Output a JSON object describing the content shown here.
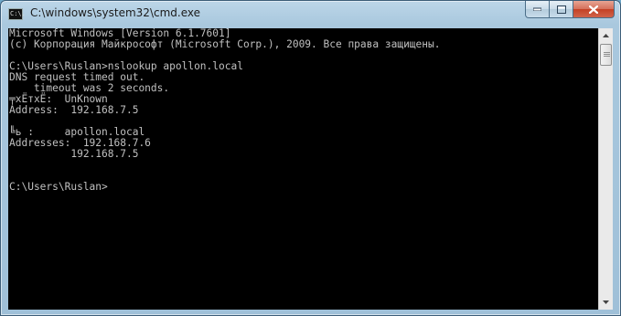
{
  "window": {
    "title": "C:\\windows\\system32\\cmd.exe",
    "icon": "cmd-icon",
    "icon_label": "C:\\.",
    "buttons": {
      "minimize": "minimize-icon",
      "maximize": "maximize-icon",
      "close": "close-icon"
    }
  },
  "console": {
    "lines": [
      "Microsoft Windows [Version 6.1.7601]",
      "(c) Корпорация Майкрософт (Microsoft Corp.), 2009. Все права защищены.",
      "",
      "C:\\Users\\Ruslan>nslookup apollon.local",
      "DNS request timed out.",
      "    timeout was 2 seconds.",
      "╤хЁтхЁ:  UnKnown",
      "Address:  192.168.7.5",
      "",
      "╚ь :     apollon.local",
      "Addresses:  192.168.7.6",
      "          192.168.7.5",
      "",
      "",
      "C:\\Users\\Ruslan>"
    ]
  },
  "colors": {
    "console_bg": "#000000",
    "console_text": "#c0c0c0",
    "close_button": "#c44125"
  }
}
